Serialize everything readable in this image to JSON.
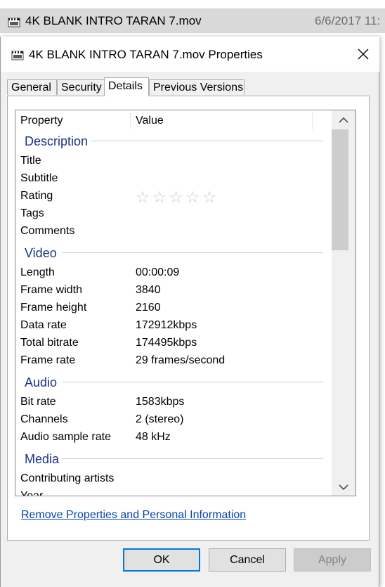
{
  "background_row": {
    "file_name": "4K BLANK INTRO TARAN 7.mov",
    "date": "6/6/2017 11:"
  },
  "file_icon": {
    "badge_text": "mov",
    "name": "mov-file-icon"
  },
  "dialog": {
    "title": "4K BLANK INTRO TARAN 7.mov Properties",
    "tabs": [
      {
        "label": "General",
        "active": false
      },
      {
        "label": "Security",
        "active": false
      },
      {
        "label": "Details",
        "active": true
      },
      {
        "label": "Previous Versions",
        "active": false
      }
    ],
    "columns": {
      "property": "Property",
      "value": "Value"
    },
    "groups": {
      "description": {
        "title": "Description",
        "rows": {
          "title": {
            "name": "Title",
            "value": ""
          },
          "subtitle": {
            "name": "Subtitle",
            "value": ""
          },
          "rating": {
            "name": "Rating",
            "stars_filled": 0,
            "stars_total": 5,
            "stars_display": "☆☆☆☆☆"
          },
          "tags": {
            "name": "Tags",
            "value": ""
          },
          "comments": {
            "name": "Comments",
            "value": ""
          }
        }
      },
      "video": {
        "title": "Video",
        "rows": {
          "length": {
            "name": "Length",
            "value": "00:00:09"
          },
          "frame_width": {
            "name": "Frame width",
            "value": "3840"
          },
          "frame_height": {
            "name": "Frame height",
            "value": "2160"
          },
          "data_rate": {
            "name": "Data rate",
            "value": "172912kbps"
          },
          "total_bitrate": {
            "name": "Total bitrate",
            "value": "174495kbps"
          },
          "frame_rate": {
            "name": "Frame rate",
            "value": "29 frames/second"
          }
        }
      },
      "audio": {
        "title": "Audio",
        "rows": {
          "bit_rate": {
            "name": "Bit rate",
            "value": "1583kbps"
          },
          "channels": {
            "name": "Channels",
            "value": "2 (stereo)"
          },
          "sample_rate": {
            "name": "Audio sample rate",
            "value": "48 kHz"
          }
        }
      },
      "media": {
        "title": "Media",
        "rows": {
          "contributing_artists": {
            "name": "Contributing artists",
            "value": ""
          },
          "year": {
            "name": "Year",
            "value": ""
          }
        }
      }
    },
    "remove_link": "Remove Properties and Personal Information",
    "buttons": {
      "ok": "OK",
      "cancel": "Cancel",
      "apply": "Apply"
    }
  },
  "colors": {
    "group_title": "#1e3287",
    "link": "#0645ad",
    "ok_border": "#0078d7",
    "dialog_bg": "#f0f0f0"
  }
}
